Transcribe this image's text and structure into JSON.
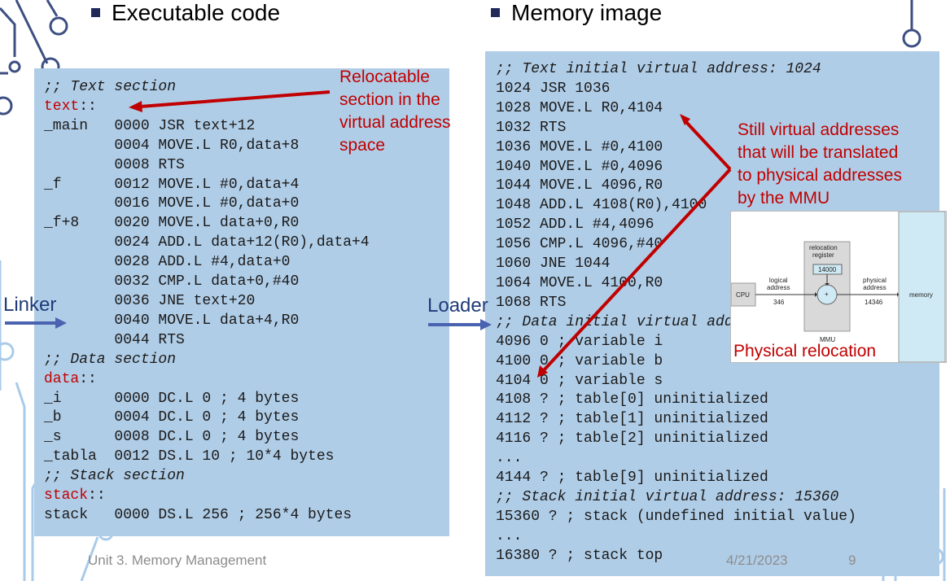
{
  "headings": {
    "left": "Executable code",
    "right": "Memory image"
  },
  "left_code": [
    {
      "text": ";; Text section",
      "style": "it"
    },
    {
      "text": "text::",
      "style": "red-label",
      "label": "text",
      "rest": "::"
    },
    {
      "text": "_main   0000 JSR text+12"
    },
    {
      "text": "        0004 MOVE.L R0,data+8"
    },
    {
      "text": "        0008 RTS"
    },
    {
      "text": "_f      0012 MOVE.L #0,data+4"
    },
    {
      "text": "        0016 MOVE.L #0,data+0"
    },
    {
      "text": "_f+8    0020 MOVE.L data+0,R0"
    },
    {
      "text": "        0024 ADD.L data+12(R0),data+4"
    },
    {
      "text": "        0028 ADD.L #4,data+0"
    },
    {
      "text": "        0032 CMP.L data+0,#40"
    },
    {
      "text": "        0036 JNE text+20"
    },
    {
      "text": "        0040 MOVE.L data+4,R0"
    },
    {
      "text": "        0044 RTS"
    },
    {
      "text": ";; Data section",
      "style": "it"
    },
    {
      "text": "data::",
      "style": "red-label",
      "label": "data",
      "rest": "::"
    },
    {
      "text": "_i      0000 DC.L 0 ; 4 bytes"
    },
    {
      "text": "_b      0004 DC.L 0 ; 4 bytes"
    },
    {
      "text": "_s      0008 DC.L 0 ; 4 bytes"
    },
    {
      "text": "_tabla  0012 DS.L 10 ; 10*4 bytes"
    },
    {
      "text": ";; Stack section",
      "style": "it"
    },
    {
      "text": "stack::",
      "style": "red-label",
      "label": "stack",
      "rest": "::"
    },
    {
      "text": "stack   0000 DS.L 256 ; 256*4 bytes"
    }
  ],
  "right_code": [
    {
      "text": ";; Text initial virtual address: 1024",
      "style": "it"
    },
    {
      "text": "1024 JSR 1036"
    },
    {
      "text": "1028 MOVE.L R0,4104"
    },
    {
      "text": "1032 RTS"
    },
    {
      "text": "1036 MOVE.L #0,4100"
    },
    {
      "text": "1040 MOVE.L #0,4096"
    },
    {
      "text": "1044 MOVE.L 4096,R0"
    },
    {
      "text": "1048 ADD.L 4108(R0),4100"
    },
    {
      "text": "1052 ADD.L #4,4096"
    },
    {
      "text": "1056 CMP.L 4096,#40"
    },
    {
      "text": "1060 JNE 1044"
    },
    {
      "text": "1064 MOVE.L 4100,R0"
    },
    {
      "text": "1068 RTS"
    },
    {
      "text": ";; Data initial virtual address: 4096",
      "style": "it"
    },
    {
      "text": "4096 0 ; variable i"
    },
    {
      "text": "4100 0 ; variable b"
    },
    {
      "text": "4104 0 ; variable s"
    },
    {
      "text": "4108 ? ; table[0] uninitialized"
    },
    {
      "text": "4112 ? ; table[1] uninitialized"
    },
    {
      "text": "4116 ? ; table[2] uninitialized"
    },
    {
      "text": "..."
    },
    {
      "text": "4144 ? ; table[9] uninitialized"
    },
    {
      "text": ";; Stack initial virtual address: 15360",
      "style": "it"
    },
    {
      "text": "15360 ? ; stack (undefined initial value)"
    },
    {
      "text": "..."
    },
    {
      "text": "16380 ? ; stack top"
    }
  ],
  "annotations": {
    "relocatable": [
      "Relocatable",
      "section in the",
      "virtual address",
      "space"
    ],
    "still_virtual": [
      "Still virtual addresses",
      "that will be translated",
      "to physical addresses",
      "by the MMU"
    ],
    "physical_relocation": "Physical relocation"
  },
  "labels": {
    "linker": "Linker",
    "loader": "Loader"
  },
  "mmu_diagram": {
    "cpu": "CPU",
    "logical_address": "logical\naddress",
    "logical_value": "346",
    "relocation_register": "relocation\nregister",
    "register_value": "14000",
    "plus": "+",
    "physical_address": "physical\naddress",
    "physical_value": "14346",
    "mmu": "MMU",
    "memory": "memory"
  },
  "footer": {
    "course": "Unit 3. Memory Management",
    "date": "4/21/2023",
    "page": "9"
  },
  "colors": {
    "panel": "#b0cde7",
    "accent_red": "#c00000",
    "arrow_blue": "#4a63b0",
    "circuit": "#9ec4e6"
  }
}
